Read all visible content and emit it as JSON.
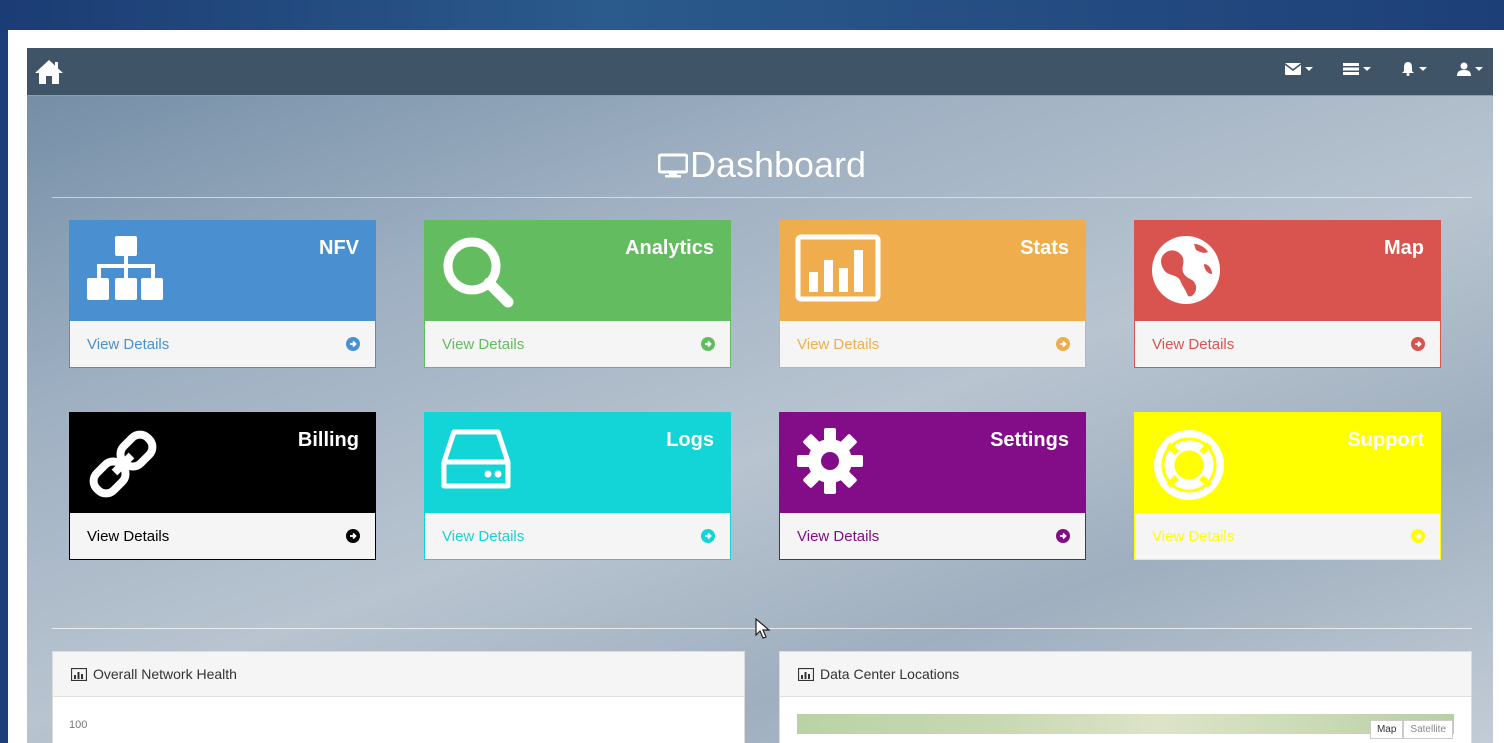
{
  "header": {
    "page_title": "Dashboard",
    "nav_icons": [
      "envelope-icon",
      "tasks-icon",
      "bell-icon",
      "user-icon"
    ]
  },
  "tiles": [
    {
      "title": "NFV",
      "icon": "sitemap-icon",
      "link": "View Details",
      "color": "#4a90d0"
    },
    {
      "title": "Analytics",
      "icon": "search-icon",
      "link": "View Details",
      "color": "#63bc5f"
    },
    {
      "title": "Stats",
      "icon": "bar-chart-icon",
      "link": "View Details",
      "color": "#f0ad4e"
    },
    {
      "title": "Map",
      "icon": "globe-icon",
      "link": "View Details",
      "color": "#d9534f"
    },
    {
      "title": "Billing",
      "icon": "link-icon",
      "link": "View Details",
      "color": "#000000"
    },
    {
      "title": "Logs",
      "icon": "hdd-icon",
      "link": "View Details",
      "color": "#13d4d6"
    },
    {
      "title": "Settings",
      "icon": "gear-icon",
      "link": "View Details",
      "color": "#830c88"
    },
    {
      "title": "Support",
      "icon": "life-ring-icon",
      "link": "View Details",
      "color": "#ffff00"
    }
  ],
  "panels": {
    "network_health": {
      "title": "Overall Network Health",
      "y_tick_top": "100"
    },
    "data_center": {
      "title": "Data Center Locations",
      "map_button": "Map",
      "satellite_button": "Satellite"
    }
  }
}
